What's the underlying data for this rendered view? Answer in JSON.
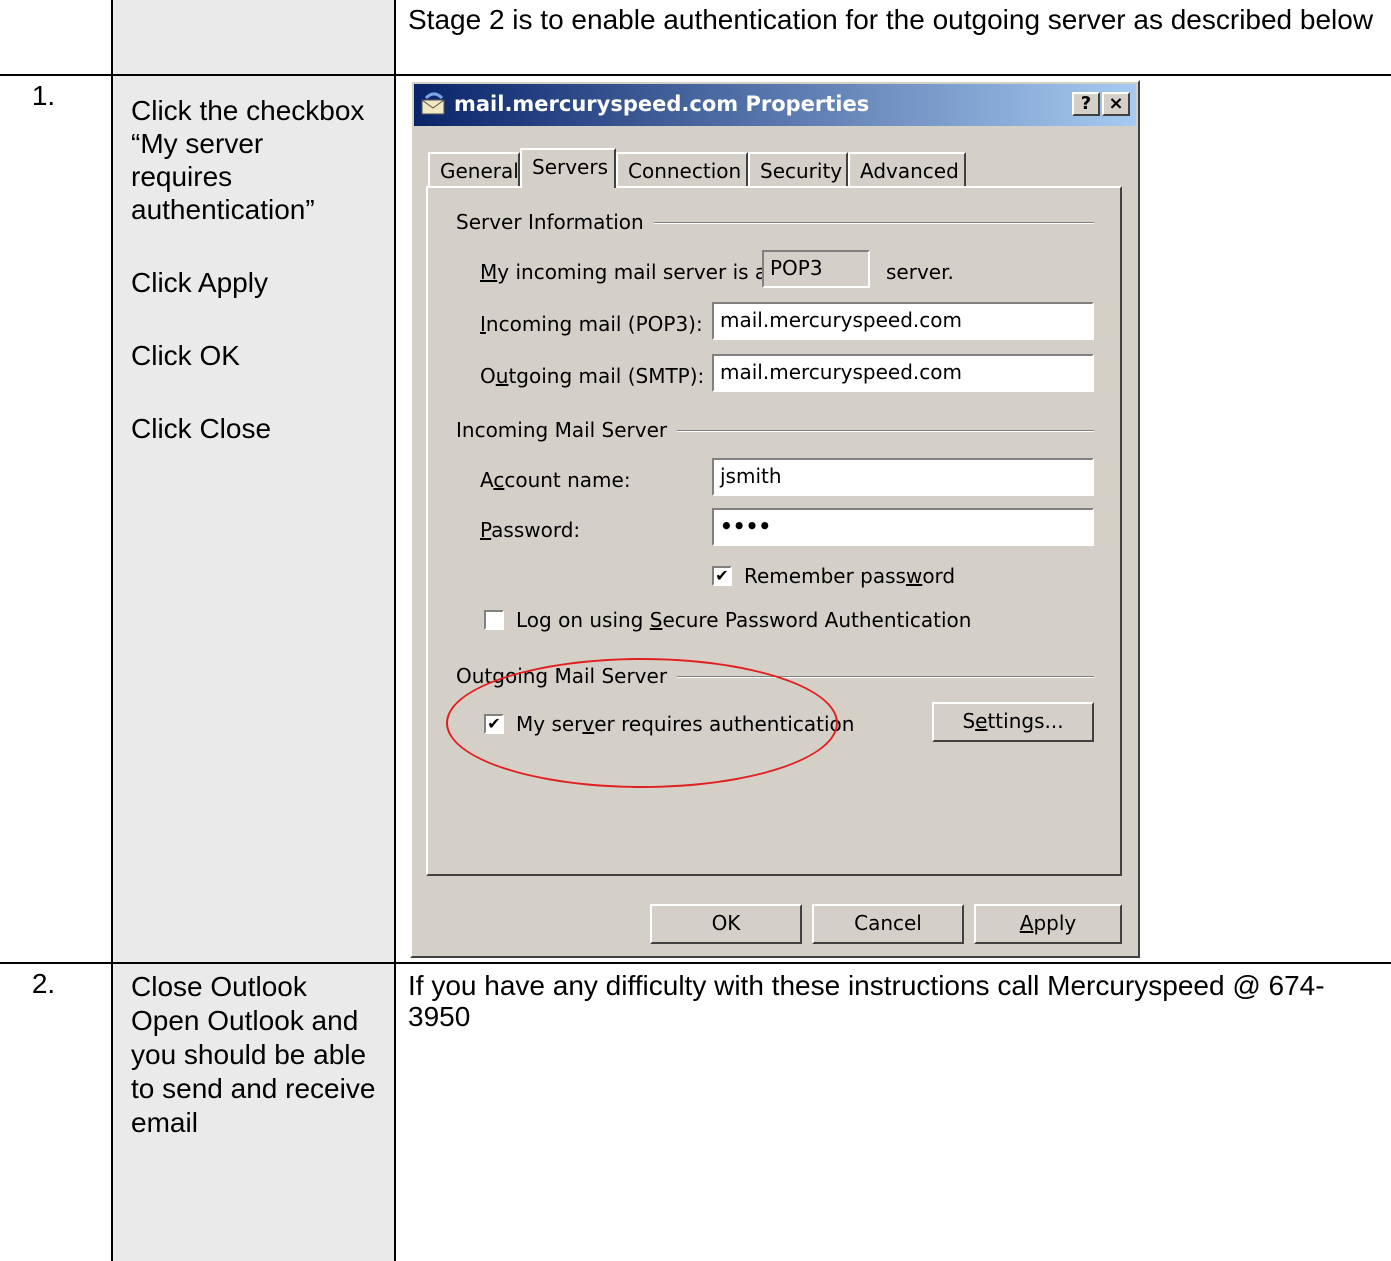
{
  "document": {
    "rows": [
      {
        "number": "",
        "steps": [],
        "content": "Stage 2 is to enable authentication for the outgoing server as described below"
      },
      {
        "number": "1.",
        "steps": [
          "Click the checkbox “My server requires authentication”",
          "Click Apply",
          "Click OK",
          "Click Close"
        ],
        "content": ""
      },
      {
        "number": "2.",
        "steps_text": "Close Outlook Open Outlook and you should be able to send and receive email",
        "content": "If you have any difficulty with these instructions call Mercuryspeed @ 674-3950"
      }
    ]
  },
  "dialog": {
    "title": "mail.mercuryspeed.com Properties",
    "help_button": "?",
    "close_button": "×",
    "tabs": [
      "General",
      "Servers",
      "Connection",
      "Security",
      "Advanced"
    ],
    "active_tab": "Servers",
    "server_info": {
      "group": "Server Information",
      "incoming_type_prefix": "y incoming mail server is a",
      "incoming_type_prefix_u": "M",
      "incoming_type_value": "POP3",
      "incoming_type_suffix": "server.",
      "incoming_label_u": "I",
      "incoming_label": "ncoming mail (POP3):",
      "incoming_value": "mail.mercuryspeed.com",
      "outgoing_label_pre": "O",
      "outgoing_label_u": "u",
      "outgoing_label": "tgoing mail (SMTP):",
      "outgoing_value": "mail.mercuryspeed.com"
    },
    "incoming_server": {
      "group": "Incoming Mail Server",
      "account_label_pre": "A",
      "account_label_u": "c",
      "account_label": "count name:",
      "account_value": "jsmith",
      "password_label_u": "P",
      "password_label": "assword:",
      "password_value": "••••",
      "remember_label_pre": "Remember pass",
      "remember_label_u": "w",
      "remember_label": "ord",
      "remember_checked": true,
      "spa_label_pre": "Log on using ",
      "spa_label_u": "S",
      "spa_label": "ecure Password Authentication",
      "spa_checked": false
    },
    "outgoing_server": {
      "group": "Outgoing Mail Server",
      "auth_label_pre": "My ser",
      "auth_label_u": "v",
      "auth_label": "er requires authentication",
      "auth_checked": true,
      "settings_pre": "S",
      "settings_u": "e",
      "settings": "ttings..."
    },
    "buttons": {
      "ok": "OK",
      "cancel": "Cancel",
      "apply_u": "A",
      "apply": "pply"
    }
  }
}
